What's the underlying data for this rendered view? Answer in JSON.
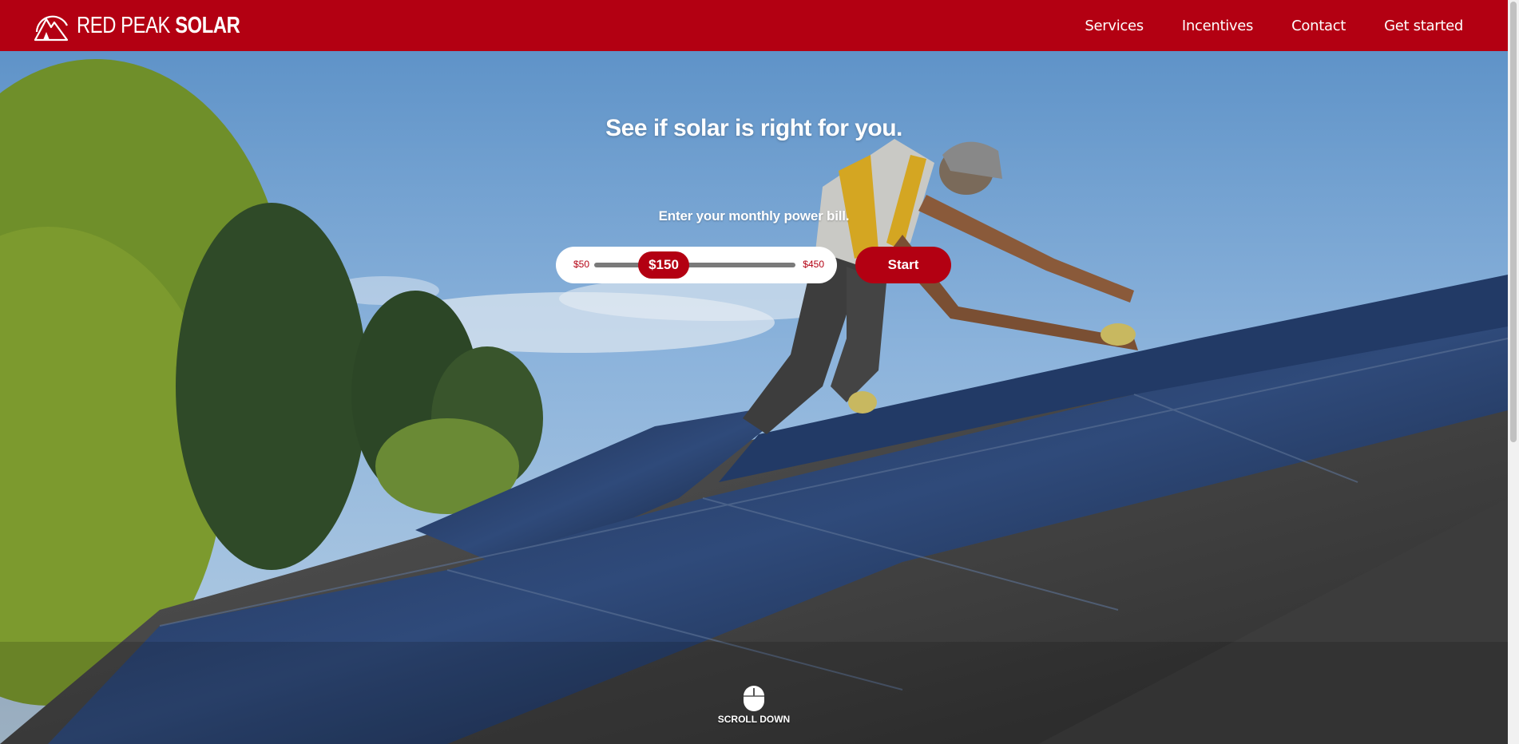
{
  "brand": {
    "name_light": "RED PEAK",
    "name_bold": "SOLAR",
    "logo_icon": "mountain-peak-icon",
    "color": "#b30012"
  },
  "nav": {
    "links": [
      {
        "label": "Services"
      },
      {
        "label": "Incentives"
      },
      {
        "label": "Contact"
      },
      {
        "label": "Get started"
      }
    ]
  },
  "hero": {
    "headline": "See if solar is right for you.",
    "prompt": "Enter your monthly power bill.",
    "background": "photo of installer on solar-panel roof with trees and blue sky",
    "slider": {
      "min_label": "$50",
      "max_label": "$450",
      "value_label": "$150",
      "value": 150,
      "min": 50,
      "max": 450
    },
    "start_label": "Start",
    "scroll_label": "SCROLL DOWN",
    "scroll_icon": "mouse-icon"
  }
}
